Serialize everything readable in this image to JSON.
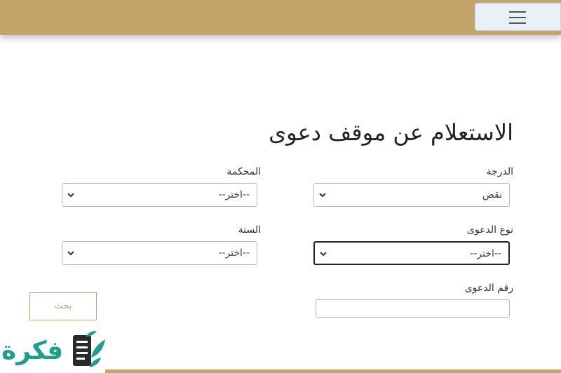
{
  "header": {
    "menu_icon": "hamburger-icon"
  },
  "form": {
    "title": "الاستعلام عن موقف دعوى",
    "degree_label": "الدرجة",
    "degree_value": "نقض",
    "court_label": "المحكمة",
    "court_value": "--اختر--",
    "case_type_label": "نوع الدعوى",
    "case_type_value": "--اختر--",
    "year_label": "السنة",
    "year_value": "--اختر--",
    "case_number_label": "رقم الدعوى",
    "case_number_value": "",
    "search_label": "بحث"
  },
  "watermark": {
    "text": "فكرة",
    "color": "#1e9e8c"
  },
  "colors": {
    "accent": "#c4a46a"
  }
}
